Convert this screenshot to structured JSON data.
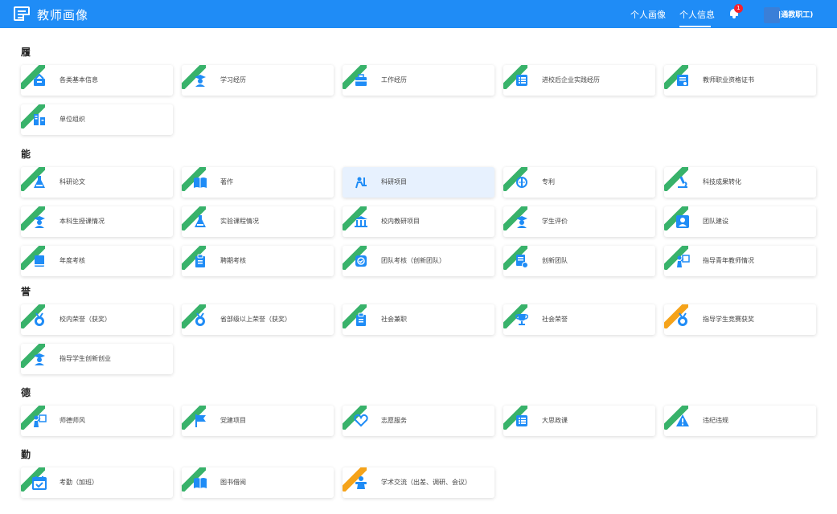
{
  "header": {
    "app_title": "教师画像",
    "nav": [
      "个人画像",
      "个人信息"
    ],
    "notification_count": "1",
    "user_name": "|通教职工)",
    "accent_color": "#1f8cf6"
  },
  "sections": [
    {
      "title": "履",
      "items": [
        {
          "label": "各类基本信息",
          "icon": "basket-icon",
          "ribbon": "green"
        },
        {
          "label": "学习经历",
          "icon": "graduate-icon",
          "ribbon": "green"
        },
        {
          "label": "工作经历",
          "icon": "briefcase-icon",
          "ribbon": "green"
        },
        {
          "label": "进校后企业实践经历",
          "icon": "list-icon",
          "ribbon": "green"
        },
        {
          "label": "教师职业资格证书",
          "icon": "certificate-icon",
          "ribbon": "green"
        },
        {
          "label": "单位组织",
          "icon": "org-icon",
          "ribbon": "green"
        }
      ]
    },
    {
      "title": "能",
      "items": [
        {
          "label": "科研论文",
          "icon": "flask-icon",
          "ribbon": "green"
        },
        {
          "label": "著作",
          "icon": "book-icon",
          "ribbon": "green"
        },
        {
          "label": "科研项目",
          "icon": "researcher-icon",
          "ribbon": "none",
          "active": true
        },
        {
          "label": "专利",
          "icon": "patent-icon",
          "ribbon": "green"
        },
        {
          "label": "科技成果转化",
          "icon": "microscope-icon",
          "ribbon": "green"
        },
        {
          "label": "本科生授课情况",
          "icon": "teacher-icon",
          "ribbon": "green"
        },
        {
          "label": "实验课程情况",
          "icon": "flask-icon",
          "ribbon": "green"
        },
        {
          "label": "校内教研项目",
          "icon": "building-icon",
          "ribbon": "green"
        },
        {
          "label": "学生评价",
          "icon": "graduate-icon",
          "ribbon": "green"
        },
        {
          "label": "团队建设",
          "icon": "person-icon",
          "ribbon": "green"
        },
        {
          "label": "年度考核",
          "icon": "notebook-icon",
          "ribbon": "green"
        },
        {
          "label": "聘期考核",
          "icon": "clipboard-icon",
          "ribbon": "green"
        },
        {
          "label": "团队考核（创新团队）",
          "icon": "checkbox-icon",
          "ribbon": "green"
        },
        {
          "label": "创新团队",
          "icon": "document-icon",
          "ribbon": "green"
        },
        {
          "label": "指导青年教师情况",
          "icon": "presenter-icon",
          "ribbon": "green"
        }
      ]
    },
    {
      "title": "誉",
      "items": [
        {
          "label": "校内荣誉（获奖）",
          "icon": "medal-icon",
          "ribbon": "green"
        },
        {
          "label": "省部级以上荣誉（获奖）",
          "icon": "medal-icon",
          "ribbon": "green"
        },
        {
          "label": "社会兼职",
          "icon": "clipboard-icon",
          "ribbon": "green"
        },
        {
          "label": "社会荣誉",
          "icon": "trophy-icon",
          "ribbon": "green"
        },
        {
          "label": "指导学生竞赛获奖",
          "icon": "medal-icon",
          "ribbon": "orange"
        },
        {
          "label": "指导学生创新创业",
          "icon": "graduate-icon",
          "ribbon": "green"
        }
      ]
    },
    {
      "title": "德",
      "items": [
        {
          "label": "师德师风",
          "icon": "presenter-icon",
          "ribbon": "green"
        },
        {
          "label": "党建项目",
          "icon": "flag-icon",
          "ribbon": "green"
        },
        {
          "label": "志愿服务",
          "icon": "heart-hand-icon",
          "ribbon": "green"
        },
        {
          "label": "大思政课",
          "icon": "list-icon",
          "ribbon": "green"
        },
        {
          "label": "违纪违规",
          "icon": "warning-icon",
          "ribbon": "green"
        }
      ]
    },
    {
      "title": "勤",
      "items": [
        {
          "label": "考勤（加班）",
          "icon": "calendar-check-icon",
          "ribbon": "green"
        },
        {
          "label": "图书借阅",
          "icon": "book-icon",
          "ribbon": "green"
        },
        {
          "label": "学术交流（出差、调研、会议）",
          "icon": "speaker-icon",
          "ribbon": "orange"
        }
      ]
    }
  ]
}
